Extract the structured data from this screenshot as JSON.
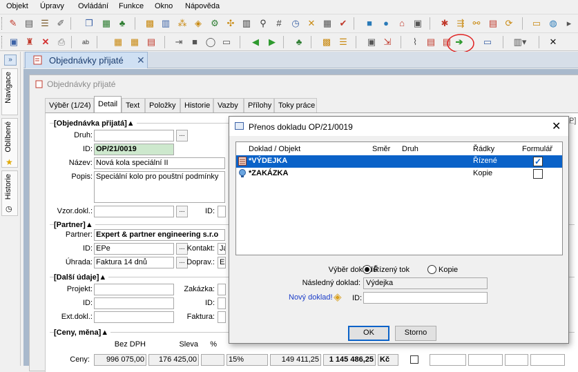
{
  "menu": [
    "Objekt",
    "Úpravy",
    "Ovládání",
    "Funkce",
    "Okno",
    "Nápověda"
  ],
  "leftpanel": {
    "expand_glyph": "»",
    "tabs": [
      "Navigace",
      "Oblíbené",
      "Historie"
    ]
  },
  "doc_tab": {
    "label": "Objednávky přijaté",
    "close": "✕"
  },
  "form": {
    "title": "Objednávky přijaté",
    "tabs": [
      "Výběr (1/24)",
      "Detail",
      "Text",
      "Položky",
      "Historie",
      "Vazby",
      "Přílohy",
      "Toky práce"
    ],
    "active_tab": "Detail",
    "order_section": {
      "heading": "[Objednávka přijatá]▲",
      "druh_label": "Druh:",
      "druh_value": "",
      "id_label": "ID:",
      "id_value": "OP/21/0019",
      "nazev_label": "Název:",
      "nazev_value": "Nová kola speciální II",
      "popis_label": "Popis:",
      "popis_value": "Speciální kolo pro pouštní podmínky",
      "vzor_label": "Vzor.dokl.:",
      "vzor_value": "",
      "id2_label": "ID:"
    },
    "partner_section": {
      "heading": "[Partner]▲",
      "partner_label": "Partner:",
      "partner_value": "Expert & partner engineering s.r.o",
      "id_label": "ID:",
      "id_value": "EPe",
      "kontakt_label": "Kontakt:",
      "kontakt_value": "Ja",
      "uhrada_label": "Úhrada:",
      "uhrada_value": "Faktura 14 dnů",
      "doprava_label": "Doprav.:",
      "doprava_value": "Ex"
    },
    "other_section": {
      "heading": "[Další údaje]▲",
      "projekt_label": "Projekt:",
      "zakazka_label": "Zakázka:",
      "id_label": "ID:",
      "id2_label": "ID:",
      "extdokl_label": "Ext.dokl.:",
      "faktura_label": "Faktura:"
    },
    "prices_section": {
      "heading": "[Ceny, měna]▲",
      "col_bezdph": "Bez DPH",
      "col_sleva": "Sleva",
      "col_pct": "%",
      "row_label": "Ceny:",
      "bezdph_value": "996 075,00",
      "sleva_value": "176 425,00",
      "pct_value": "15%",
      "dph_value": "149 411,25",
      "total_value": "1 145 486,25",
      "currency": "Kč"
    }
  },
  "dialog": {
    "title": "Přenos dokladu OP/21/0019",
    "close": "✕",
    "columns": [
      "Doklad / Objekt",
      "Směr",
      "Druh",
      "Řádky",
      "Formulář"
    ],
    "rows": [
      {
        "doklad": "*VÝDEJKA",
        "smer": "",
        "druh": "",
        "radky": "Řízené",
        "formular": true,
        "selected": true
      },
      {
        "doklad": "*ZAKÁZKA",
        "smer": "",
        "druh": "",
        "radky": "Kopie",
        "formular": false,
        "selected": false
      }
    ],
    "vyber_label": "Výběr dokladů:",
    "radio_rizeny": "Řízený tok",
    "radio_kopie": "Kopie",
    "nasledny_label": "Následný doklad:",
    "nasledny_value": "Výdejka",
    "novy_label": "Nový doklad!",
    "id_label": "ID:",
    "id_value": "",
    "ok_label": "OK",
    "storno_label": "Storno"
  }
}
